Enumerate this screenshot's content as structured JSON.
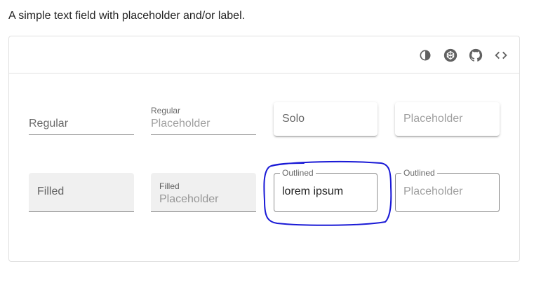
{
  "description": "A simple text field with placeholder and/or label.",
  "toolbar": {
    "icons": [
      "invert-colors-icon",
      "codepen-icon",
      "github-icon",
      "code-icon"
    ]
  },
  "fields": {
    "regular": {
      "label": "Regular"
    },
    "regular_placeholder": {
      "label": "Regular",
      "placeholder": "Placeholder"
    },
    "solo": {
      "label": "Solo"
    },
    "solo_placeholder": {
      "placeholder": "Placeholder"
    },
    "filled": {
      "label": "Filled"
    },
    "filled_placeholder": {
      "label": "Filled",
      "placeholder": "Placeholder"
    },
    "outlined": {
      "label": "Outlined",
      "value": "lorem ipsum"
    },
    "outlined_placeholder": {
      "label": "Outlined",
      "placeholder": "Placeholder"
    }
  },
  "colors": {
    "annotation": "#1a1ad6",
    "filled_bg": "#f0f0f0",
    "border": "#e0e0e0"
  }
}
